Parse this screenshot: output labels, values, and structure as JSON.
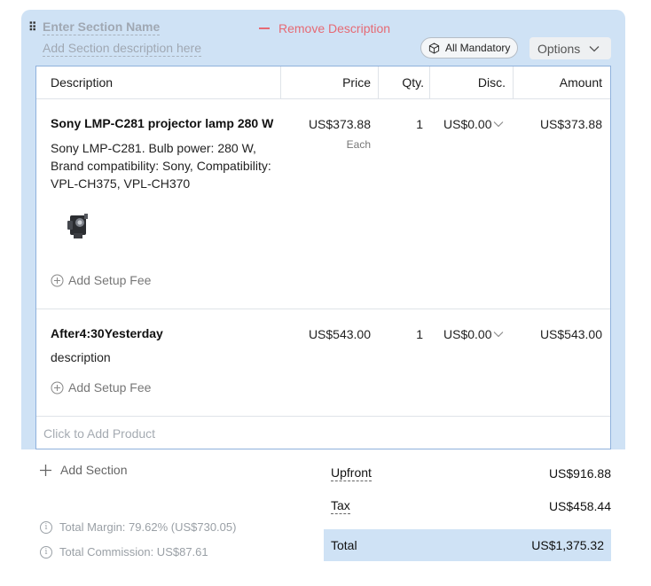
{
  "section": {
    "name_placeholder": "Enter Section Name",
    "desc_placeholder": "Add Section description here",
    "remove_description": "Remove Description",
    "all_mandatory": "All Mandatory",
    "options": "Options"
  },
  "table": {
    "headers": [
      "Description",
      "Price",
      "Qty.",
      "Disc.",
      "Amount"
    ],
    "rows": [
      {
        "name": "Sony LMP-C281 projector lamp 280 W",
        "description": "Sony LMP-C281. Bulb power: 280 W, Brand compatibility: Sony, Compatibility: VPL-CH375, VPL-CH370",
        "price": "US$373.88",
        "price_unit": "Each",
        "qty": "1",
        "disc": "US$0.00",
        "amount": "US$373.88",
        "setup_fee": "Add Setup Fee"
      },
      {
        "name": "After4:30Yesterday",
        "description": "description",
        "price": "US$543.00",
        "qty": "1",
        "disc": "US$0.00",
        "amount": "US$543.00",
        "setup_fee": "Add Setup Fee"
      }
    ],
    "add_product": "Click to Add Product"
  },
  "add_section": "Add Section",
  "totals": {
    "upfront_label": "Upfront",
    "upfront_value": "US$916.88",
    "tax_label": "Tax",
    "tax_value": "US$458.44",
    "total_label": "Total",
    "total_value": "US$1,375.32"
  },
  "metrics": {
    "margin": "Total Margin:  79.62% (US$730.05)",
    "commission": "Total Commission:  US$87.61"
  },
  "colors": {
    "section_bg": "#cfe2f5",
    "remove_red": "#e66a74",
    "table_border": "#8fb1dc"
  },
  "icons": [
    "drag-handle-icon",
    "minus-icon",
    "cube-icon",
    "chevron-down-icon",
    "plus-circle-icon",
    "plus-icon",
    "info-icon"
  ]
}
